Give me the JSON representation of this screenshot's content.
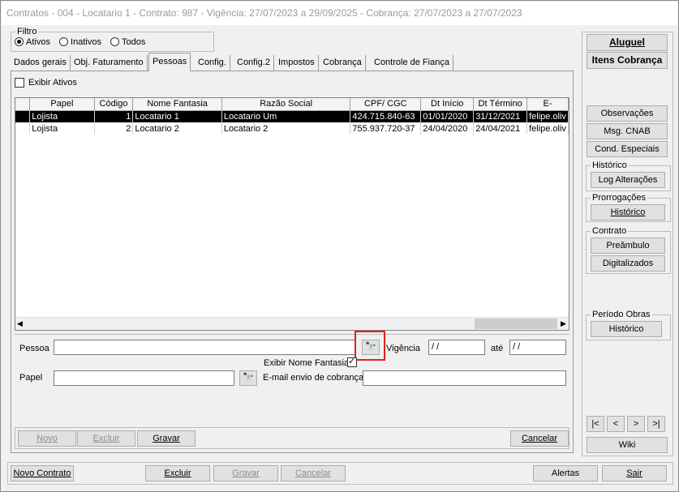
{
  "window": {
    "title": "Contratos - 004 - Locatario 1 - Contrato: 987 - Vigência: 27/07/2023 a 29/09/2025 - Cobrança: 27/07/2023 a 27/07/2023"
  },
  "filter": {
    "legend": "Filtro",
    "options": [
      "Ativos",
      "Inativos",
      "Todos"
    ],
    "selected": "Ativos"
  },
  "tabs": [
    "Dados gerais",
    "Obj. Faturamento",
    "Pessoas",
    "Config.",
    "Config.2",
    "Impostos",
    "Cobrança",
    "Controle de Fiança"
  ],
  "active_tab": "Pessoas",
  "pessoas": {
    "exibir_ativos_label": "Exibir Ativos",
    "columns": [
      "Papel",
      "Código",
      "Nome Fantasia",
      "Razão Social",
      "CPF/ CGC",
      "Dt Início",
      "Dt Término",
      "E-"
    ],
    "rows": [
      {
        "papel": "Lojista",
        "codigo": "1",
        "nome": "Locatario 1",
        "razao": "Locatario Um",
        "cpf": "424.715.840-63",
        "inicio": "01/01/2020",
        "termino": "31/12/2021",
        "email": "felipe.oliv"
      },
      {
        "papel": "Lojista",
        "codigo": "2",
        "nome": "Locatario 2",
        "razao": "Locatario 2",
        "cpf": "755.937.720-37",
        "inicio": "24/04/2020",
        "termino": "24/04/2021",
        "email": "felipe.oliv"
      }
    ],
    "form": {
      "pessoa_label": "Pessoa",
      "vigencia_label": "Vigência",
      "vigencia_de": " / /",
      "ate_label": "até",
      "vigencia_ate": " / /",
      "exibir_nome_fantasia_label": "Exibir Nome Fantasia",
      "papel_label": "Papel",
      "email_label": "E-mail envio de cobrança"
    },
    "buttons": {
      "novo": "Novo",
      "excluir": "Excluir",
      "gravar": "Gravar",
      "cancelar": "Cancelar"
    }
  },
  "right_panel": {
    "aluguel": "Aluguel",
    "itens_cobranca": "Itens Cobrança",
    "observacoes": "Observações",
    "msg_cnab": "Msg. CNAB",
    "cond_especiais": "Cond. Especiais",
    "historico_legend": "Histórico",
    "log_alteracoes": "Log Alterações",
    "prorrogacoes_legend": "Prorrogações",
    "prorrogacoes_historico": "Histórico",
    "contrato_legend": "Contrato",
    "preambulo": "Preâmbulo",
    "digitalizados": "Digitalizados",
    "periodo_obras_legend": "Período Obras",
    "periodo_obras_historico": "Histórico",
    "nav": [
      "|<",
      "<",
      ">",
      ">|"
    ],
    "wiki": "Wiki"
  },
  "bottom_bar": {
    "novo_contrato": "Novo Contrato",
    "excluir": "Excluir",
    "gravar": "Gravar",
    "cancelar": "Cancelar",
    "alertas": "Alertas",
    "sair": "Sair"
  }
}
